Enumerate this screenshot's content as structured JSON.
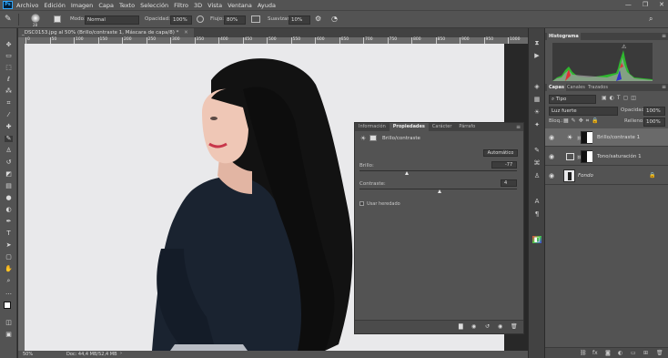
{
  "app": {
    "logo": "Ps",
    "title": "Adobe Photoshop"
  },
  "menu": [
    "Archivo",
    "Edición",
    "Imagen",
    "Capa",
    "Texto",
    "Selección",
    "Filtro",
    "3D",
    "Vista",
    "Ventana",
    "Ayuda"
  ],
  "window_controls": {
    "minimize": "—",
    "restore": "❐",
    "close": "✕"
  },
  "options": {
    "brush_size": "28",
    "mode_label": "Modo:",
    "mode_value": "Normal",
    "opacity_label": "Opacidad:",
    "opacity_value": "100%",
    "flow_label": "Flujo:",
    "flow_value": "80%",
    "smooth_label": "Suavizar:",
    "smooth_value": "10%"
  },
  "document": {
    "tab_title": "_DSC0153.jpg al 50% (Brillo/contraste 1, Máscara de capa/8) *",
    "ruler_marks": [
      "0",
      "50",
      "100",
      "150",
      "200",
      "250",
      "300",
      "350",
      "400",
      "450",
      "500",
      "550",
      "600",
      "650",
      "700",
      "750",
      "800",
      "850",
      "900",
      "950",
      "1000"
    ],
    "zoom": "50%",
    "doc_info": "Doc: 44,4 MB/52,4 MB"
  },
  "properties": {
    "tabs": [
      "Información",
      "Propiedades",
      "Carácter",
      "Párrafo"
    ],
    "active_tab": 1,
    "header": "Brillo/contraste",
    "auto_button": "Automático",
    "brightness_label": "Brillo:",
    "brightness_value": "-77",
    "brightness_fraction": 0.3,
    "contrast_label": "Contraste:",
    "contrast_value": "4",
    "contrast_fraction": 0.51,
    "legacy_label": "Usar heredado"
  },
  "histogram": {
    "tab": "Histograma"
  },
  "layers_panel": {
    "tabs": [
      "Capas",
      "Canales",
      "Trazados"
    ],
    "filter_label": "Tipo",
    "blend_mode": "Luz fuerte",
    "opacity_label": "Opacidad:",
    "opacity_value": "100%",
    "lock_label": "Bloq.:",
    "fill_label": "Relleno:",
    "fill_value": "100%",
    "layers": [
      {
        "name": "Brillo/contraste 1",
        "selected": true
      },
      {
        "name": "Tono/saturación 1",
        "selected": false
      },
      {
        "name": "Fondo",
        "selected": false
      }
    ]
  },
  "colors": {
    "accent": "#31a8ff",
    "panel": "#535353",
    "canvas": "#e9e9eb"
  }
}
